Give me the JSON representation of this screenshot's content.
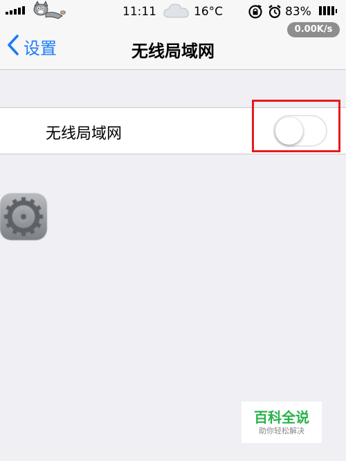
{
  "status_bar": {
    "time": "11:11",
    "temperature": "16°C",
    "battery_percent": "83%",
    "network_speed": "0.00K/s",
    "icons": [
      "signal-icon",
      "cat-icon",
      "cloud-icon",
      "rotation-lock-icon",
      "alarm-icon",
      "battery-icon"
    ]
  },
  "nav": {
    "back_label": "设置",
    "title": "无线局域网"
  },
  "wifi_cell": {
    "label": "无线局域网",
    "toggle_on": false
  },
  "watermark": {
    "title": "百科全说",
    "subtitle": "助你轻松解决"
  },
  "colors": {
    "accent": "#1a7cf5",
    "highlight": "#e8191e",
    "background": "#efeff4",
    "watermark_green": "#27b24a"
  }
}
